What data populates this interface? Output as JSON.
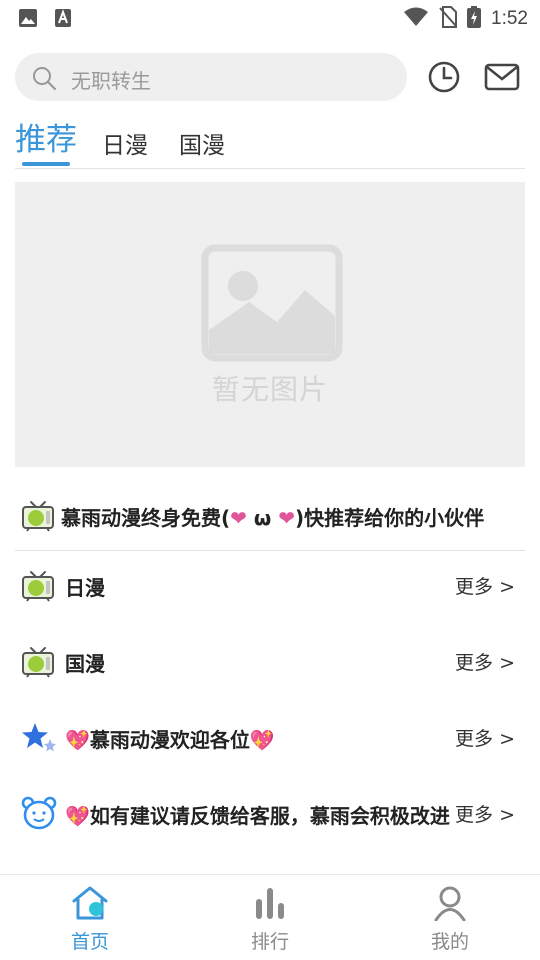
{
  "status_bar": {
    "time": "1:52"
  },
  "search": {
    "placeholder": "无职转生"
  },
  "tabs": [
    {
      "label": "推荐",
      "active": true
    },
    {
      "label": "日漫",
      "active": false
    },
    {
      "label": "国漫",
      "active": false
    }
  ],
  "banner": {
    "placeholder_text": "暂无图片"
  },
  "notice": {
    "text": "慕雨动漫终身免费(❤ ω ❤)快推荐给你的小伙伴"
  },
  "sections": [
    {
      "title": "日漫",
      "more": "更多 >",
      "icon": "tv-icon"
    },
    {
      "title": "国漫",
      "more": "更多 >",
      "icon": "tv-icon"
    },
    {
      "title": "💖慕雨动漫欢迎各位💖",
      "more": "更多 >",
      "icon": "stars-icon"
    },
    {
      "title": "💖如有建议请反馈给客服，慕雨会积极改进",
      "more": "更多 >",
      "icon": "bear-icon"
    }
  ],
  "bottom_nav": [
    {
      "label": "首页",
      "icon": "home-icon",
      "active": true
    },
    {
      "label": "排行",
      "icon": "ranking-icon",
      "active": false
    },
    {
      "label": "我的",
      "icon": "profile-icon",
      "active": false
    }
  ],
  "colors": {
    "accent": "#3a96d8",
    "background": "#ffffff",
    "search_bg": "#efefef",
    "heart": "#e0559a"
  }
}
